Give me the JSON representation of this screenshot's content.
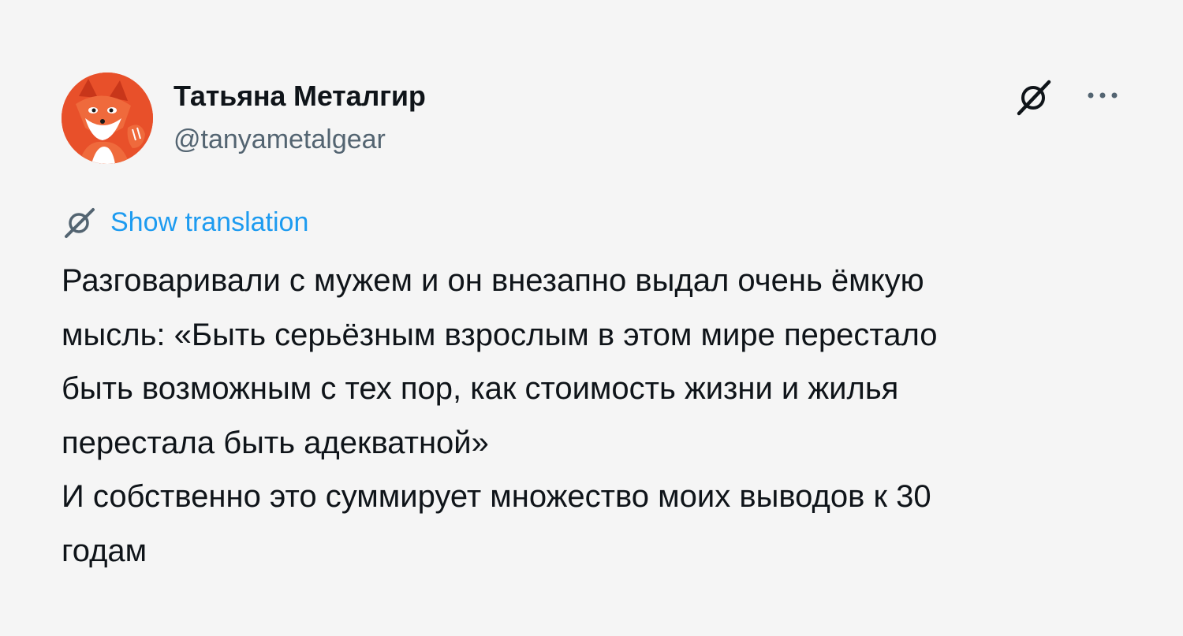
{
  "author": {
    "display_name": "Татьяна Металгир",
    "handle": "@tanyametalgear",
    "avatar_icon": "fox-avatar-icon"
  },
  "actions": {
    "grok_icon": "grok-icon",
    "more_icon": "more-options-icon",
    "more_glyph": "···"
  },
  "translation": {
    "icon": "grok-icon",
    "label": "Show translation",
    "color": "#1d9bf0"
  },
  "tweet": {
    "lines": [
      "Разговаривали с мужем и он внезапно выдал очень ёмкую",
      "мысль: «Быть серьёзным взрослым в этом мире перестало",
      "быть возможным с тех пор, как стоимость жизни и жилья",
      "перестала быть адекватной»",
      "И собственно это суммирует множество моих выводов к 30",
      "годам"
    ]
  },
  "colors": {
    "background": "#f5f5f5",
    "text": "#0f1419",
    "secondary_text": "#536471",
    "accent": "#1d9bf0",
    "avatar_bg": "#e8502a"
  }
}
